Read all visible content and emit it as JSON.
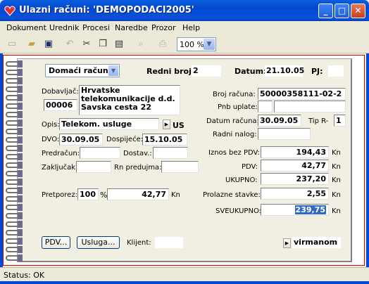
{
  "window": {
    "title": "Ulazni računi: 'DEMOPODACI2005'",
    "minimize": "_",
    "maximize": "□",
    "close": "✕"
  },
  "menu": [
    "Dokument",
    "Urednik",
    "Procesi",
    "Naredbe",
    "Prozor",
    "Help"
  ],
  "toolbar": {
    "zoom": "100 %"
  },
  "header": {
    "doc_type": "Domaći računi",
    "redni_broj_label": "Redni broj:",
    "redni_broj": "2",
    "datum_label": "Datum:",
    "datum": "21.10.05",
    "pj_label": "PJ:",
    "pj": ""
  },
  "left": {
    "dobavljac_label": "Dobavljač:",
    "supplier_code": "00006",
    "supplier_name": [
      "Hrvatske",
      "telekomunikacije d.d.",
      "Savska cesta 22"
    ],
    "opis_label": "Opis:",
    "opis": "Telekom. usluge",
    "us": "US",
    "dvo_label": "DVO:",
    "dvo": "30.09.05",
    "dospijece_label": "Dospijeće:",
    "dospijece": "15.10.05",
    "predracun_label": "Predračun:",
    "predracun": "",
    "dostav_label": "Dostav.:",
    "dostav": "",
    "zakljucak_label": "Zaključak:",
    "zakljucak": "",
    "rn_predujma_label": "Rn predujma:",
    "rn_predujma": "",
    "pretporez_label": "Pretporez:",
    "pretporez_pct": "100",
    "pct_sign": "%",
    "pretporez_iznos": "42,77",
    "kn": "Kn"
  },
  "right": {
    "broj_racuna_label": "Broj računa:",
    "broj_racuna": "50000358111-02-2",
    "pnb_label": "Pnb uplate:",
    "pnb1": "",
    "pnb2": "",
    "datum_racuna_label": "Datum računa:",
    "datum_racuna": "30.09.05",
    "tip_label": "Tip R-",
    "tip": "1",
    "radni_nalog_label": "Radni nalog:",
    "radni_nalog": "",
    "iznos_bez_pdv_label": "Iznos bez PDV:",
    "iznos_bez_pdv": "194,43",
    "pdv_label": "PDV:",
    "pdv": "42,77",
    "ukupno_label": "UKUPNO:",
    "ukupno": "237,20",
    "prolazne_label": "Prolazne stavke:",
    "prolazne": "2,55",
    "sveukupno_label": "SVEUKUPNO:",
    "sveukupno": "239,75",
    "kn": "Kn"
  },
  "footer": {
    "pdv_button": "PDV...",
    "usluga_button": "Usluga...",
    "klijent_label": "Klijent:",
    "klijent": "",
    "payment": "virmanom"
  },
  "status": {
    "text": "Status: OK"
  },
  "colors": {
    "titlebar": "#0a5fe0",
    "frame_border": "#d00000",
    "selection": "#316ac5"
  }
}
